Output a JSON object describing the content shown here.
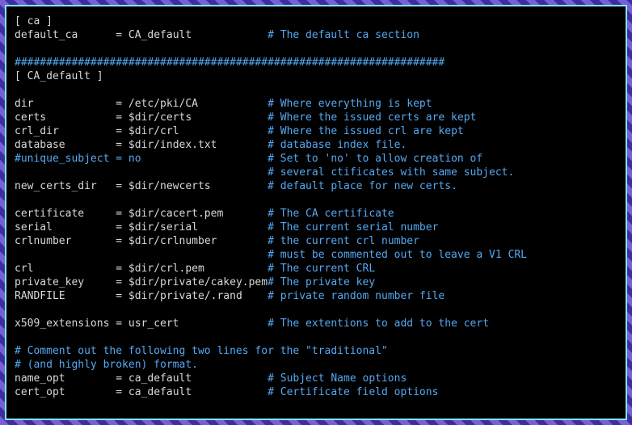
{
  "lines": {
    "l1_key": "[ ca ]",
    "l2_key": "default_ca",
    "l2_val": "= CA_default",
    "l2_cmt": "# The default ca section",
    "l3_hash": "####################################################################",
    "l4_key": "[ CA_default ]",
    "l5_key": "dir",
    "l5_val": "= /etc/pki/CA",
    "l5_cmt": "# Where everything is kept",
    "l6_key": "certs",
    "l6_val": "= $dir/certs",
    "l6_cmt": "# Where the issued certs are kept",
    "l7_key": "crl_dir",
    "l7_val": "= $dir/crl",
    "l7_cmt": "# Where the issued crl are kept",
    "l8_key": "database",
    "l8_val": "= $dir/index.txt",
    "l8_cmt": "# database index file.",
    "l9_line": "#unique_subject = no",
    "l9_cmt": "# Set to 'no' to allow creation of",
    "l10_cmt": "# several ctificates with same subject.",
    "l11_key": "new_certs_dir",
    "l11_val": "= $dir/newcerts",
    "l11_cmt": "# default place for new certs.",
    "l12_key": "certificate",
    "l12_val": "= $dir/cacert.pem",
    "l12_cmt": "# The CA certificate",
    "l13_key": "serial",
    "l13_val": "= $dir/serial",
    "l13_cmt": "# The current serial number",
    "l14_key": "crlnumber",
    "l14_val": "= $dir/crlnumber",
    "l14_cmt": "# the current crl number",
    "l15_cmt": "# must be commented out to leave a V1 CRL",
    "l16_key": "crl",
    "l16_val": "= $dir/crl.pem",
    "l16_cmt": "# The current CRL",
    "l17_key": "private_key",
    "l17_val": "= $dir/private/cakey.pem",
    "l17_cmt": "# The private key",
    "l18_key": "RANDFILE",
    "l18_val": "= $dir/private/.rand",
    "l18_cmt": "# private random number file",
    "l19_key": "x509_extensions",
    "l19_val": "= usr_cert",
    "l19_cmt": "# The extentions to add to the cert",
    "l20_cmt": "# Comment out the following two lines for the \"traditional\"",
    "l21_cmt": "# (and highly broken) format.",
    "l22_key": "name_opt",
    "l22_val": "= ca_default",
    "l22_cmt": "# Subject Name options",
    "l23_key": "cert_opt",
    "l23_val": "= ca_default",
    "l23_cmt": "# Certificate field options"
  }
}
